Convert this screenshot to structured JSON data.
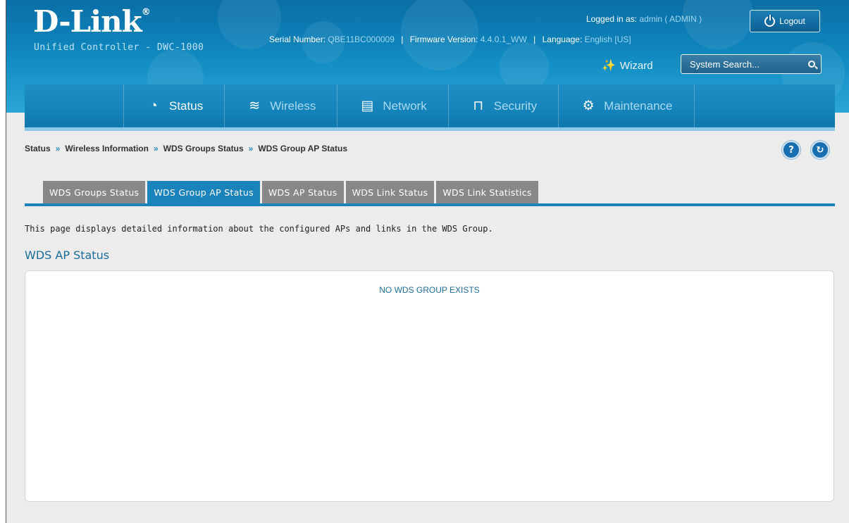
{
  "header": {
    "logo": "D-Link",
    "logo_mark": "®",
    "subtitle": "Unified Controller - DWC-1000",
    "logged_in_label": "Logged in as:",
    "logged_in_value": "admin ( ADMIN )",
    "logout_label": "Logout",
    "serial_label": "Serial Number:",
    "serial_value": "QBE11BC000009",
    "firmware_label": "Firmware Version:",
    "firmware_value": "4.4.0.1_WW",
    "language_label": "Language:",
    "language_value": "English [US]",
    "wizard_label": "Wizard",
    "search_placeholder": "System Search..."
  },
  "nav": {
    "items": [
      {
        "label": "Status",
        "icon": "dashboard-icon",
        "active": true
      },
      {
        "label": "Wireless",
        "icon": "wifi-icon",
        "active": false
      },
      {
        "label": "Network",
        "icon": "computer-icon",
        "active": false
      },
      {
        "label": "Security",
        "icon": "lock-icon",
        "active": false
      },
      {
        "label": "Maintenance",
        "icon": "gears-icon",
        "active": false
      }
    ]
  },
  "breadcrumb": {
    "items": [
      "Status",
      "Wireless Information",
      "WDS Groups Status",
      "WDS Group AP Status"
    ],
    "separator": "»"
  },
  "help_label": "?",
  "refresh_label": "↻",
  "tabs": [
    {
      "label": "WDS Groups Status",
      "active": false
    },
    {
      "label": "WDS Group AP Status",
      "active": true
    },
    {
      "label": "WDS AP Status",
      "active": false
    },
    {
      "label": "WDS Link Status",
      "active": false
    },
    {
      "label": "WDS Link Statistics",
      "active": false
    }
  ],
  "main": {
    "description": "This page displays detailed information about the configured APs and links in the WDS Group.",
    "section_title": "WDS AP Status",
    "empty_message": "NO WDS GROUP EXISTS"
  },
  "colors": {
    "accent": "#1b83bc",
    "header_bg": "#0d80b8",
    "tab_inactive": "#888888"
  }
}
